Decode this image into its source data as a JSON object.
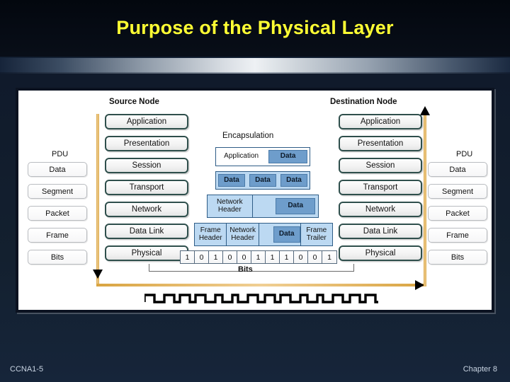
{
  "slide": {
    "title": "Purpose of the Physical Layer",
    "title_color": "#ffff33",
    "background_color": "#111c2e"
  },
  "footer": {
    "left": "CCNA1-5",
    "right": "Chapter 8"
  },
  "diagram": {
    "source_node_heading": "Source Node",
    "destination_node_heading": "Destination Node",
    "encapsulation_heading": "Encapsulation",
    "pdu_label_left": "PDU",
    "pdu_label_right": "PDU",
    "bits_caption": "Bits",
    "osi_layers": [
      "Application",
      "Presentation",
      "Session",
      "Transport",
      "Network",
      "Data Link",
      "Physical"
    ],
    "pdu_units": [
      "Data",
      "Segment",
      "Packet",
      "Frame",
      "Bits"
    ],
    "encapsulation_rows": [
      {
        "name": "application-data",
        "cells": [
          {
            "label": "Application",
            "style": "plain"
          },
          {
            "label": "Data",
            "style": "data"
          }
        ]
      },
      {
        "name": "segments",
        "cells": [
          {
            "label": "Data",
            "style": "data"
          },
          {
            "label": "Data",
            "style": "data"
          },
          {
            "label": "Data",
            "style": "data"
          }
        ]
      },
      {
        "name": "packet",
        "cells": [
          {
            "label": "Network\nHeader",
            "style": "header"
          },
          {
            "label": "",
            "style": "plain"
          },
          {
            "label": "Data",
            "style": "data"
          }
        ]
      },
      {
        "name": "frame",
        "cells": [
          {
            "label": "Frame\nHeader",
            "style": "header"
          },
          {
            "label": "Network\nHeader",
            "style": "header"
          },
          {
            "label": "",
            "style": "plain"
          },
          {
            "label": "Data",
            "style": "data"
          },
          {
            "label": "Frame\nTrailer",
            "style": "header"
          }
        ]
      }
    ],
    "bits": [
      "1",
      "0",
      "1",
      "0",
      "0",
      "1",
      "1",
      "1",
      "0",
      "0",
      "1"
    ],
    "flow_colors": {
      "path": "#d9a441",
      "arrow": "#000000",
      "layer_border": "#2f4f4c",
      "encap_border": "#2e5c86",
      "data_block": "#6e9dcb",
      "header_block": "#bcd9f2"
    }
  }
}
